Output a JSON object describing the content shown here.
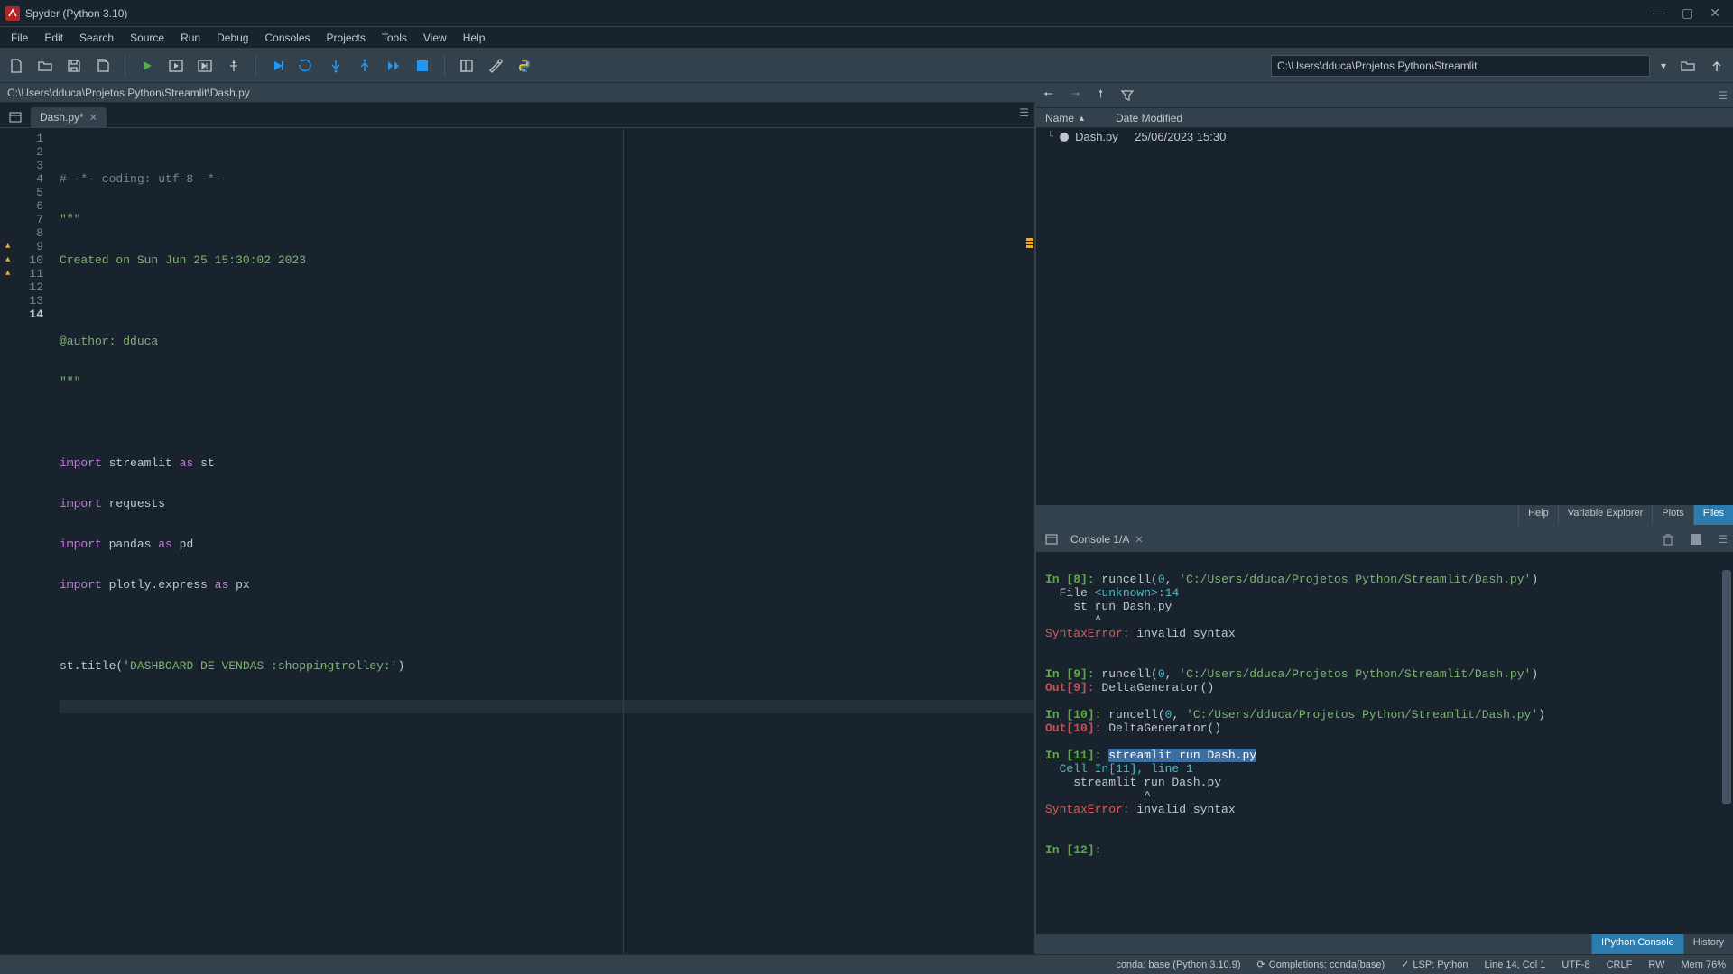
{
  "window": {
    "title": "Spyder (Python 3.10)"
  },
  "menu": [
    "File",
    "Edit",
    "Search",
    "Source",
    "Run",
    "Debug",
    "Consoles",
    "Projects",
    "Tools",
    "View",
    "Help"
  ],
  "toolbar_path": "C:\\Users\\dduca\\Projetos Python\\Streamlit",
  "breadcrumb": "C:\\Users\\dduca\\Projetos Python\\Streamlit\\Dash.py",
  "tab": {
    "label": "Dash.py*"
  },
  "gutter": {
    "lines": [
      "1",
      "2",
      "3",
      "4",
      "5",
      "6",
      "7",
      "8",
      "9",
      "10",
      "11",
      "12",
      "13",
      "14"
    ],
    "warnings": [
      9,
      10,
      11
    ]
  },
  "code": {
    "l1": "# -*- coding: utf-8 -*-",
    "l2": "\"\"\"",
    "l3": "Created on Sun Jun 25 15:30:02 2023",
    "l5": "@author: dduca",
    "l6": "\"\"\"",
    "import": "import",
    "as": "as",
    "st_title": "st.title",
    "streamlit": "streamlit",
    "st": "st",
    "requests": "requests",
    "pandas": "pandas",
    "pd": "pd",
    "plotly": "plotly.express",
    "px": "px",
    "title_str": "'DASHBOARD DE VENDAS :shoppingtrolley:'"
  },
  "file_explorer": {
    "cols": {
      "name": "Name",
      "date": "Date Modified"
    },
    "rows": [
      {
        "name": "Dash.py",
        "date": "25/06/2023 15:30"
      }
    ]
  },
  "side_tabs": [
    "Help",
    "Variable Explorer",
    "Plots",
    "Files"
  ],
  "console": {
    "tab": "Console 1/A",
    "in8_label": "In [8]:",
    "in8_cmd": "runcell(",
    "in8_num": "0",
    "in8_path": "'C:/Users/dduca/Projetos Python/Streamlit/Dash.py'",
    "in8_close": ")",
    "file_line_a": "  File ",
    "file_line_b": "<unknown>:14",
    "stmt1": "    st run Dash.py",
    "caret1": "       ^",
    "synerr": "SyntaxError:",
    "synmsg": " invalid syntax",
    "in9_label": "In [9]:",
    "out9_label": "Out[9]:",
    "deltagen": "DeltaGenerator()",
    "in10_label": "In [10]:",
    "in10_path": "'C:/Users/dduca/Projetos Python/Streamlit/Dash.py'",
    "out10_label": "Out[10]:",
    "in11_label": "In [11]:",
    "in11_cmd": "streamlit run Dash.py",
    "cell_line": "  Cell In[11], line 1",
    "stmt2": "    streamlit run Dash.py",
    "caret2": "              ^",
    "in12_label": "In [12]:"
  },
  "bottom_tabs": [
    "IPython Console",
    "History"
  ],
  "status": {
    "env": "conda: base (Python 3.10.9)",
    "completions": "Completions: conda(base)",
    "lsp": "LSP: Python",
    "pos": "Line 14, Col 1",
    "enc": "UTF-8",
    "eol": "CRLF",
    "rw": "RW",
    "mem": "Mem 76%"
  }
}
